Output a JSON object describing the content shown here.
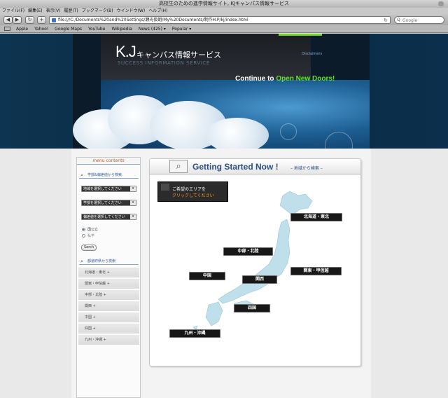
{
  "window": {
    "title": "高校生のための進学情報サイト, KJキャンパス情報サービス"
  },
  "menu": [
    "ファイル(F)",
    "編集(E)",
    "表示(V)",
    "履歴(T)",
    "ブックマーク(B)",
    "ウインドウ(W)",
    "ヘルプ(H)"
  ],
  "toolbar": {
    "back": "◀",
    "forward": "▶",
    "reload": "↻",
    "add": "+",
    "url": "file:///C:/Documents%20and%20Settings/瀬光俊朗/My%20Documents/制作H.P/kj/index.html",
    "search_placeholder": "Google",
    "search_icon": "Q"
  },
  "bookmarks": [
    "Apple",
    "Yahoo!",
    "Google Maps",
    "YouTube",
    "Wikipedia",
    "News (425) ▾",
    "Popular ▾"
  ],
  "hero": {
    "logo": "K.J",
    "logo_jp": "キャンパス情報サービス",
    "logo_sub": "SUCCESS INFORMATION SERVICE",
    "disclaimers": "Disclaimers",
    "tagline_prefix": "Continue to ",
    "tagline_highlight": "Open New Doors!"
  },
  "sidebar": {
    "title": "menu contents",
    "search_head": "学部&偏差値から検索",
    "selects": [
      "地域を選択してください",
      "学部を選択してください",
      "偏差値を選択してください"
    ],
    "radios": [
      "国公立",
      "私学"
    ],
    "search_button": "Serch",
    "pref_head": "都道府県から検索",
    "prefectures": [
      "北海道・東北 +",
      "関東・甲信越 +",
      "中部・北陸 +",
      "関西 +",
      "中国 +",
      "四国 +",
      "九州・沖縄 +"
    ]
  },
  "main": {
    "title": "Getting Started Now !",
    "subtitle": "– 地域から検索 –",
    "area_button_line1": "ご希望のエリアを",
    "area_button_line2": "クリックしてください",
    "regions": {
      "hokkaido": "北海道・東北",
      "chubu": "中部・北陸",
      "kanto": "関東・甲信越",
      "chugoku": "中国",
      "kansai": "関西",
      "shikoku": "四国",
      "kyushu": "九州・沖縄"
    }
  },
  "colors": {
    "accent_green": "#62e12c",
    "title_blue": "#2d4f80",
    "highlight_orange": "#ff9a24"
  }
}
